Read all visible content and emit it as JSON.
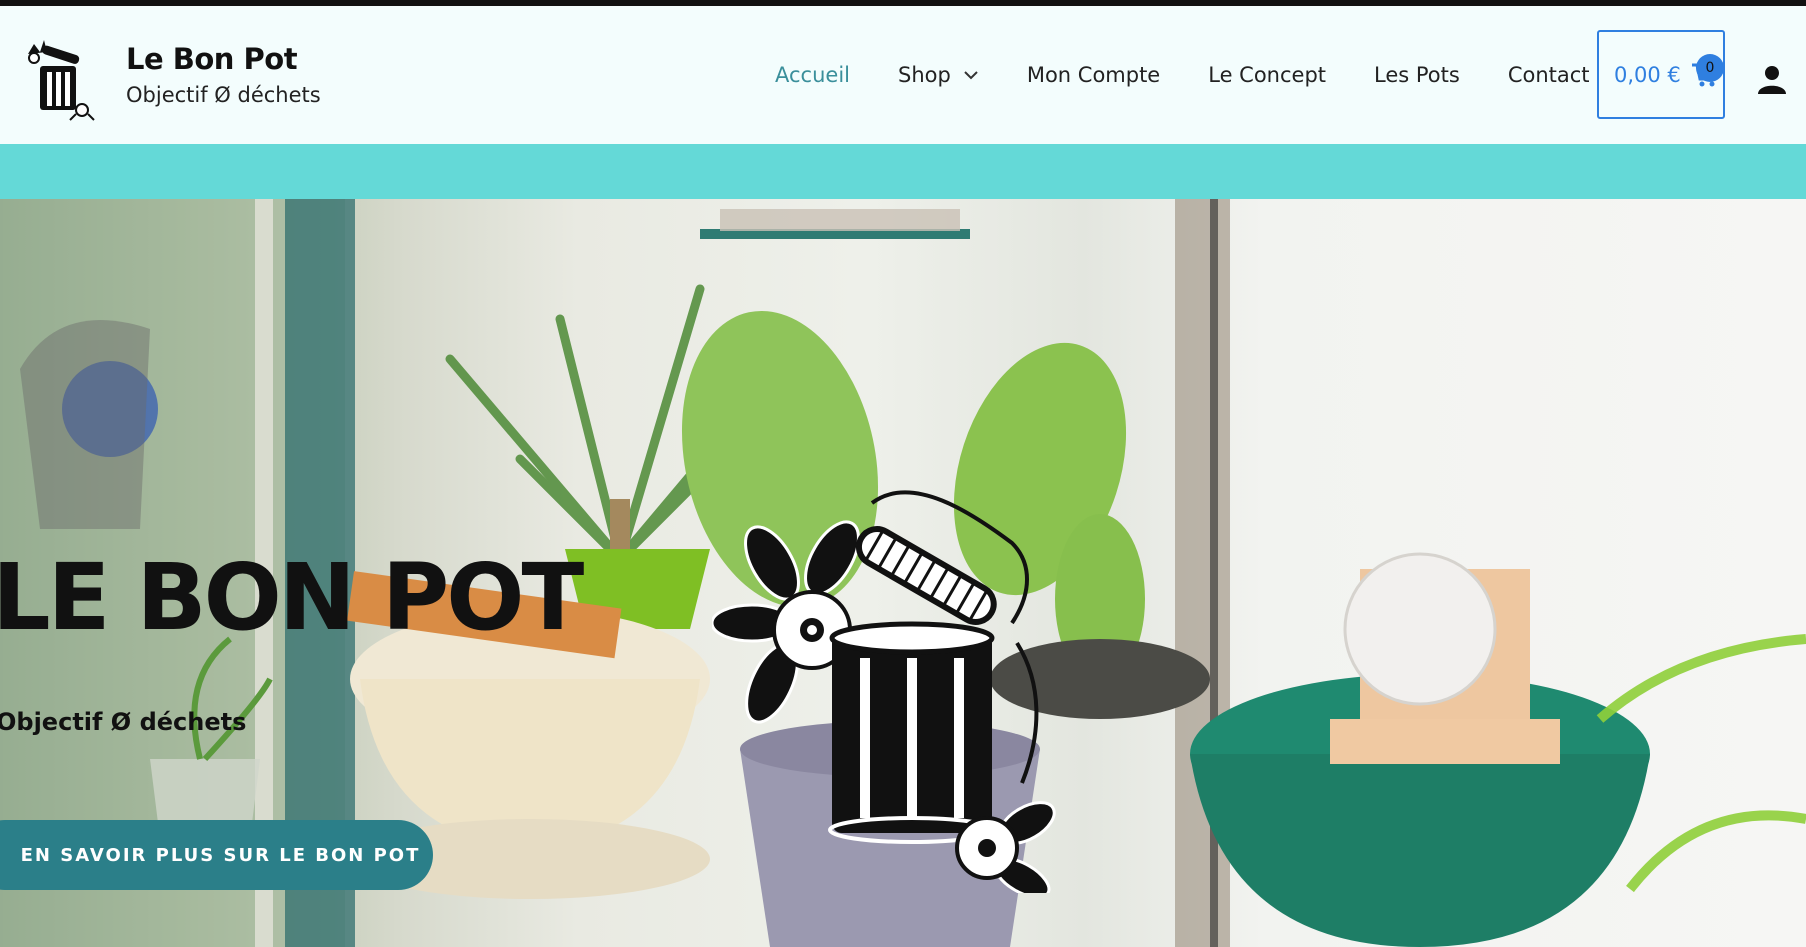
{
  "header": {
    "brand_title": "Le Bon Pot",
    "brand_tagline": "Objectif Ø déchets",
    "nav": [
      {
        "label": "Accueil",
        "active": true
      },
      {
        "label": "Shop",
        "has_dropdown": true
      },
      {
        "label": "Mon Compte"
      },
      {
        "label": "Le Concept"
      },
      {
        "label": "Les Pots"
      },
      {
        "label": "Contact"
      }
    ],
    "cart": {
      "amount": "0,00 €",
      "count": "0"
    }
  },
  "hero": {
    "title": "LE BON POT",
    "subtitle": "Objectif Ø déchets",
    "button_label": "EN SAVOIR PLUS SUR LE BON POT"
  },
  "colors": {
    "accent_nav": "#3a8f9b",
    "cart_blue": "#2f7fe0",
    "teal_bar": "#64d9d7",
    "button_teal": "#2b7f89"
  },
  "icons": [
    "logo-pot-icon",
    "chevron-down-icon",
    "cart-icon",
    "user-icon"
  ]
}
